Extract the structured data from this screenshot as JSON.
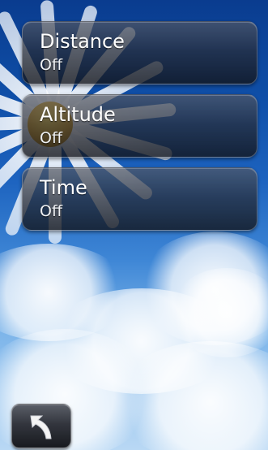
{
  "settings": {
    "items": [
      {
        "title": "Distance",
        "value": "Off"
      },
      {
        "title": "Altitude",
        "value": "Off"
      },
      {
        "title": "Time",
        "value": "Off"
      }
    ]
  },
  "footer": {
    "back_icon": "back-arrow-icon"
  },
  "colors": {
    "sky_top": "#0a3c8f",
    "sky_bottom": "#b9d8f4",
    "button_dark": "#181a1f",
    "text": "#ffffff"
  }
}
